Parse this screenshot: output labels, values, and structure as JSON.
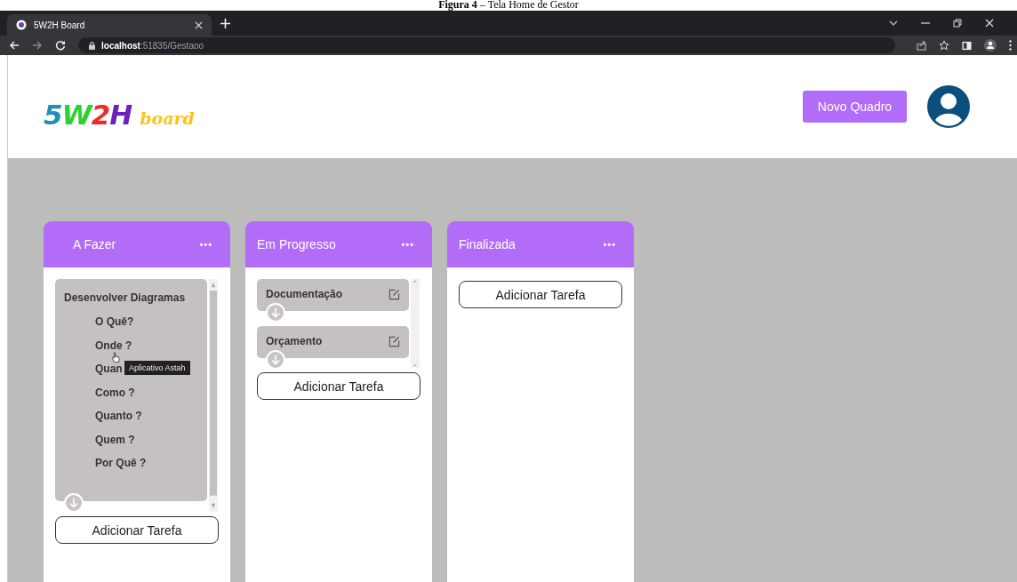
{
  "caption": "**Figura 4** – Tela Home de Gestor",
  "browser": {
    "tabs": [
      {
        "title": "5W2H Board",
        "selected": true
      }
    ],
    "url_host": "localhost",
    "url_rest": ":51835/Gestaoo"
  },
  "header": {
    "logo": [
      {
        "text": "5",
        "color": "#1f8fb3"
      },
      {
        "text": "W",
        "color": "#2fd12f"
      },
      {
        "text": "2",
        "color": "#ee2a2a"
      },
      {
        "text": "H",
        "color": "#6a22b8"
      }
    ],
    "logo_word": "board",
    "new_board_button": "Novo Quadro"
  },
  "columns": [
    {
      "title": "A Fazer",
      "menu": "•••",
      "cards": [
        {
          "title": "Desenvolver Diagramas",
          "expanded": true,
          "items": [
            {
              "text": "O Quê?"
            },
            {
              "text": "Onde ?"
            },
            {
              "text": "Quan",
              "tooltip": "Aplicativo Astah"
            },
            {
              "text": "Como ?"
            },
            {
              "text": "Quanto ?"
            },
            {
              "text": "Quem ?"
            },
            {
              "text": "Por Quê ?"
            }
          ]
        }
      ],
      "add_button": "Adicionar Tarefa"
    },
    {
      "title": "Em Progresso",
      "menu": "•••",
      "cards": [
        {
          "title": "Documentação",
          "expanded": false
        },
        {
          "title": "Orçamento",
          "expanded": false
        }
      ],
      "add_button": "Adicionar Tarefa"
    },
    {
      "title": "Finalizada",
      "menu": "•••",
      "add_button": "Adicionar Tarefa"
    }
  ]
}
